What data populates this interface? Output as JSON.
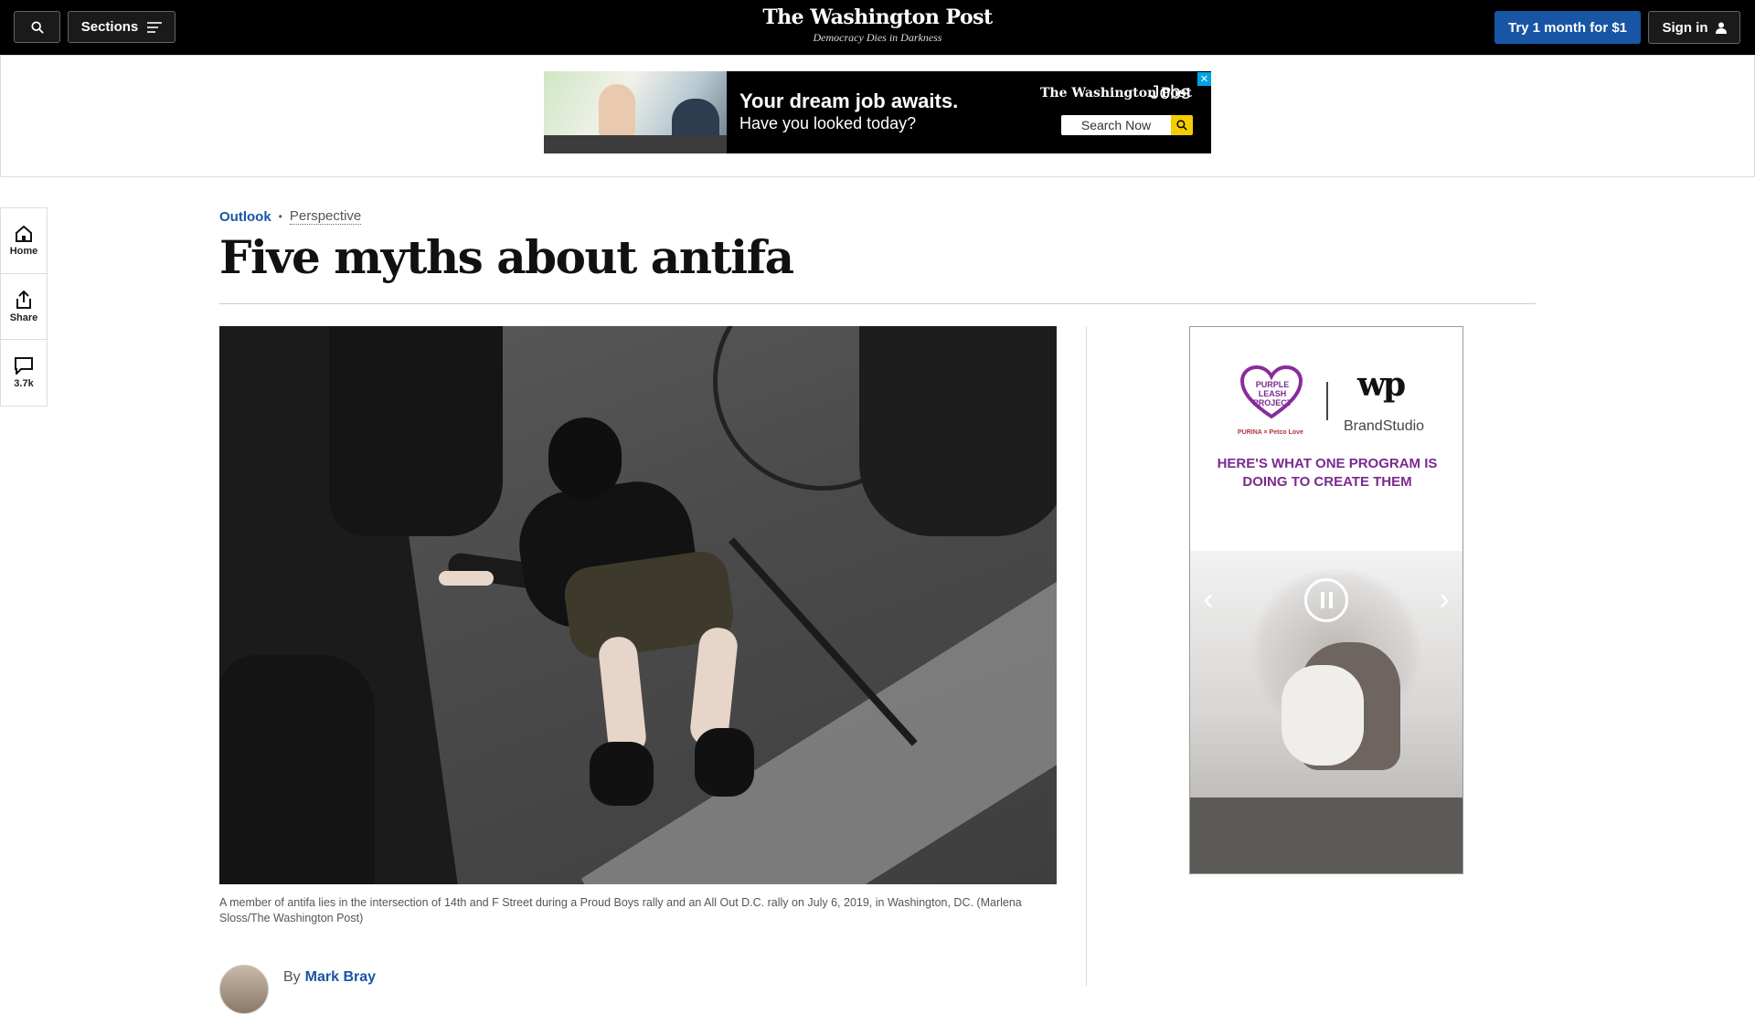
{
  "topbar": {
    "sections_label": "Sections",
    "masthead": "The Washington Post",
    "tagline": "Democracy Dies in Darkness",
    "subscribe_label": "Try 1 month for $1",
    "signin_label": "Sign in"
  },
  "banner_ad": {
    "headline": "Your dream job awaits.",
    "subline": "Have you looked today?",
    "brand": "The Washington Post",
    "jobs": "Jobs",
    "search_label": "Search Now"
  },
  "rail": {
    "home_label": "Home",
    "share_label": "Share",
    "comments_count": "3.7k"
  },
  "article": {
    "section": "Outlook",
    "label": "Perspective",
    "headline": "Five myths about antifa",
    "caption": "A member of antifa lies in the intersection of 14th and F Street during a Proud Boys rally and an All Out D.C. rally on July 6, 2019, in Washington, DC. (Marlena Sloss/The Washington Post)",
    "by": "By",
    "author": "Mark Bray"
  },
  "side_ad": {
    "partner_label": "PURPLE LEASH PROJECT",
    "partner_sub": "PURINA × Petco Love",
    "wp_mark": "wp",
    "studio": "BrandStudio",
    "headline": "HERE'S WHAT ONE PROGRAM IS DOING TO CREATE THEM"
  },
  "colors": {
    "accent_blue": "#1955a5",
    "ad_purple": "#7a2a8f",
    "topbar_bg": "#000000"
  }
}
